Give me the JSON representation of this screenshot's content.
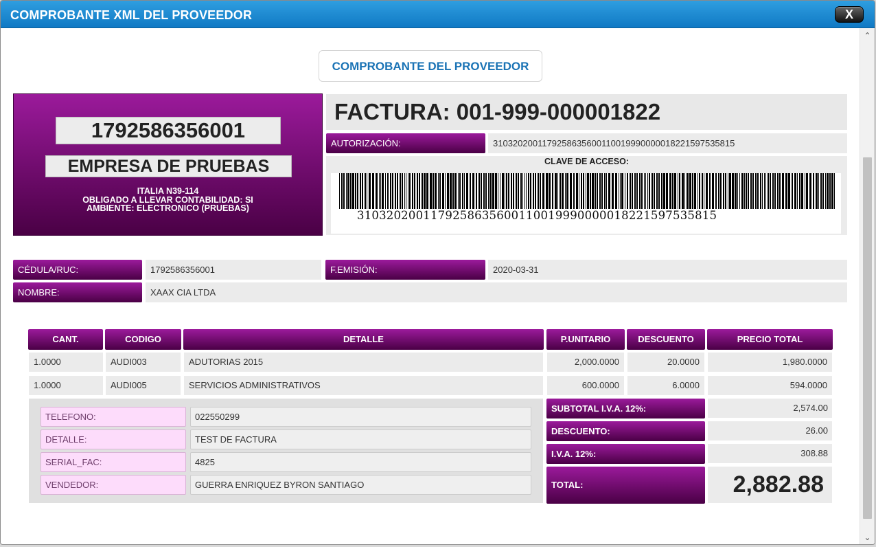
{
  "window": {
    "title": "COMPROBANTE XML DEL PROVEEDOR",
    "close_label": "X"
  },
  "header_button": "COMPROBANTE DEL PROVEEDOR",
  "company": {
    "ruc": "1792586356001",
    "name": "EMPRESA DE PRUEBAS",
    "address": "ITALIA N39-114",
    "contabilidad": "OBLIGADO A LLEVAR CONTABILIDAD: SI",
    "ambiente": "AMBIENTE: ELECTRONICO (PRUEBAS)"
  },
  "factura": {
    "title": "FACTURA: 001-999-000001822",
    "autorizacion_label": "AUTORIZACIÓN:",
    "autorizacion_value": "3103202001179258635600110019990000018221597535815",
    "clave_label": "CLAVE DE ACCESO:",
    "clave_value": "3103202001179258635600110019990000018221597535815"
  },
  "cliente": {
    "cedula_label": "CÉDULA/RUC:",
    "cedula_value": "1792586356001",
    "fecha_label": "F.EMISIÓN:",
    "fecha_value": "2020-03-31",
    "nombre_label": "NOMBRE:",
    "nombre_value": "XAAX CIA LTDA"
  },
  "table": {
    "headers": [
      "CANT.",
      "CODIGO",
      "DETALLE",
      "P.UNITARIO",
      "DESCUENTO",
      "PRECIO TOTAL"
    ],
    "rows": [
      [
        "1.0000",
        "AUDI003",
        "ADUTORIAS 2015",
        "2,000.0000",
        "20.0000",
        "1,980.0000"
      ],
      [
        "1.0000",
        "AUDI005",
        "SERVICIOS ADMINISTRATIVOS",
        "600.0000",
        "6.0000",
        "594.0000"
      ]
    ]
  },
  "extra": [
    {
      "label": "TELEFONO:",
      "value": "022550299"
    },
    {
      "label": "DETALLE:",
      "value": "TEST DE FACTURA"
    },
    {
      "label": "SERIAL_FAC:",
      "value": "4825"
    },
    {
      "label": "VENDEDOR:",
      "value": "GUERRA ENRIQUEZ BYRON SANTIAGO"
    }
  ],
  "totals": {
    "subtotal_label": "SUBTOTAL I.V.A. 12%:",
    "subtotal_value": "2,574.00",
    "descuento_label": "DESCUENTO:",
    "descuento_value": "26.00",
    "iva_label": "I.V.A. 12%:",
    "iva_value": "308.88",
    "total_label": "TOTAL:",
    "total_value": "2,882.88"
  },
  "colors": {
    "accent_purple": "#7a0f78",
    "titlebar_blue": "#1a86cf",
    "pink_label": "#fddcfb"
  }
}
